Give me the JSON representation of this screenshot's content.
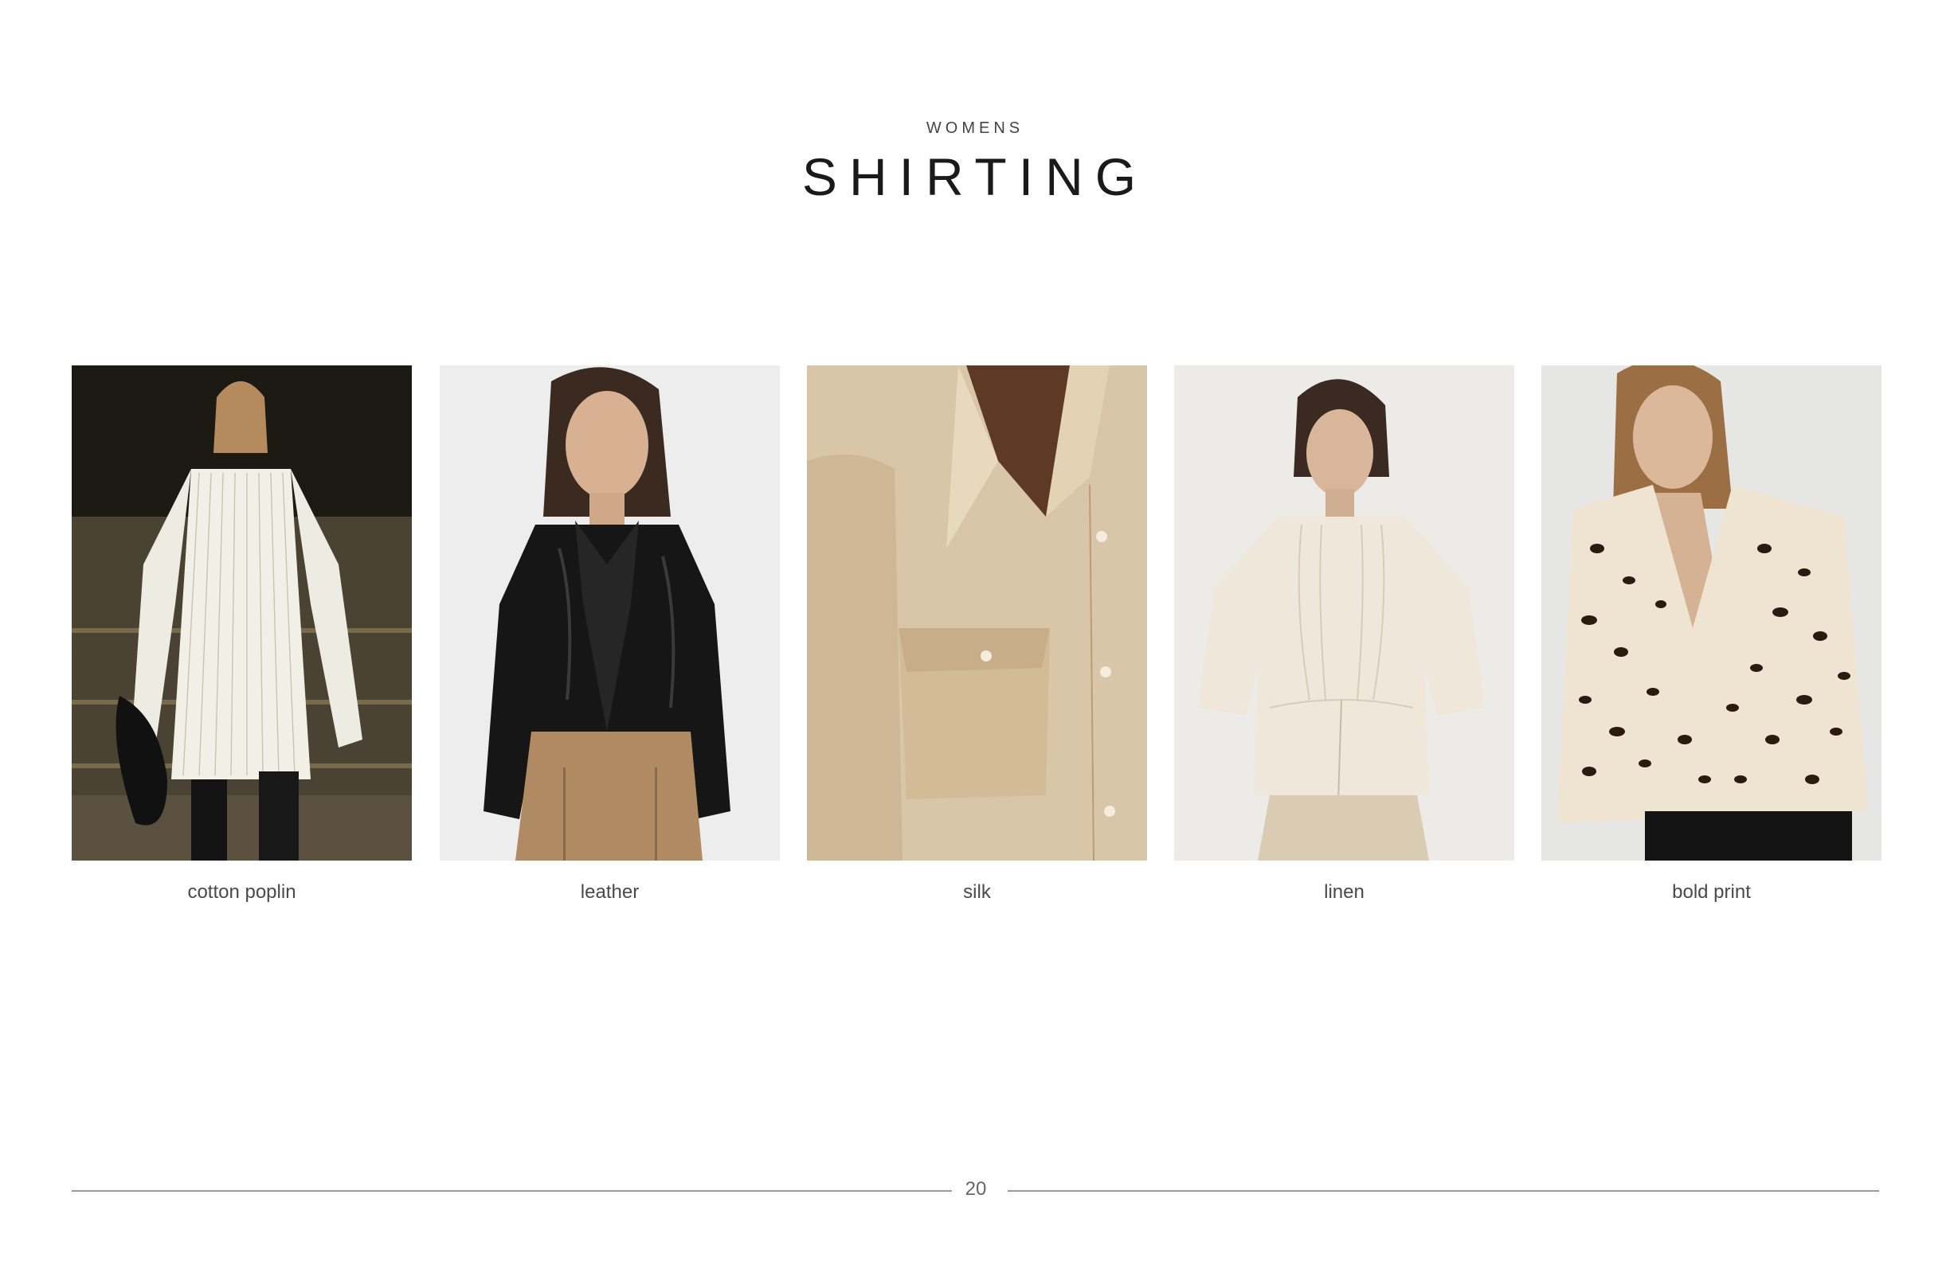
{
  "header": {
    "eyebrow": "WOMENS",
    "title": "SHIRTING"
  },
  "items": [
    {
      "label": "cotton poplin",
      "image": "model-striped-white-shirt-runway"
    },
    {
      "label": "leather",
      "image": "model-black-leather-shirt"
    },
    {
      "label": "silk",
      "image": "beige-silk-shirt-pocket-closeup"
    },
    {
      "label": "linen",
      "image": "model-cream-linen-gathered-blouse"
    },
    {
      "label": "bold print",
      "image": "model-leopard-print-shirt"
    }
  ],
  "footer": {
    "page_number": "20"
  }
}
